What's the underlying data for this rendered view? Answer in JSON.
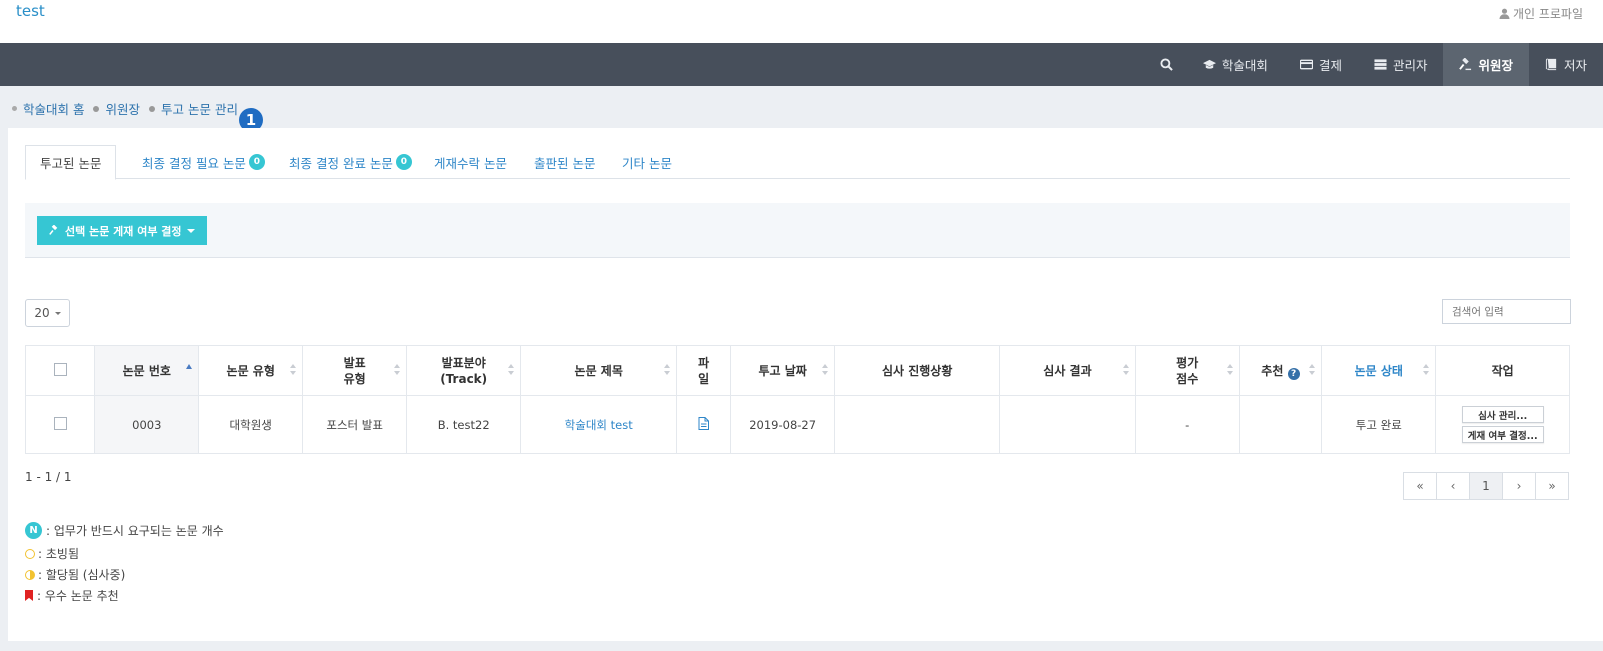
{
  "app": {
    "brand": "test",
    "profile_label": "개인 프로파일"
  },
  "nav": {
    "search_icon": "search-icon",
    "items": [
      {
        "label": "학술대회",
        "icon": "graduation-cap-icon"
      },
      {
        "label": "결제",
        "icon": "credit-card-icon"
      },
      {
        "label": "관리자",
        "icon": "server-icon"
      },
      {
        "label": "위원장",
        "icon": "gavel-icon",
        "active": true
      },
      {
        "label": "저자",
        "icon": "book-icon"
      }
    ]
  },
  "breadcrumb": [
    "학술대회 홈",
    "위원장",
    "투고 논문 관리"
  ],
  "step_badge": "1",
  "tabs": [
    {
      "label": "투고된 논문",
      "active": true
    },
    {
      "label": "최종 결정 필요 논문",
      "badge": "0"
    },
    {
      "label": "최종 결정 완료 논문",
      "badge": "0"
    },
    {
      "label": "게재수락 논문"
    },
    {
      "label": "출판된 논문"
    },
    {
      "label": "기타 논문"
    }
  ],
  "action": {
    "label": "선택 논문 게재 여부 결정"
  },
  "page_size": "20",
  "search": {
    "placeholder": "검색어 입력"
  },
  "table": {
    "headers": [
      "논문 번호",
      "논문 유형",
      "발표\n유형",
      "발표분야\n(Track)",
      "논문 제목",
      "파\n일",
      "투고 날짜",
      "심사 진행상황",
      "심사 결과",
      "평가\n점수",
      "추천",
      "논문 상태",
      "작업"
    ],
    "rows": [
      {
        "id": "0003",
        "type": "대학원생",
        "presentation": "포스터 발표",
        "track": "B. test22",
        "title": "학술대회 test",
        "date": "2019-08-27",
        "progress": "",
        "result": "",
        "score": "-",
        "recommend": "",
        "status": "투고 완료",
        "btn_review": "심사 관리...",
        "btn_decide": "게재 여부 결정..."
      }
    ]
  },
  "count_text": "1 - 1 / 1",
  "pager": [
    "«",
    "‹",
    "1",
    "›",
    "»"
  ],
  "legend": {
    "n_badge": "N",
    "required": ": 업무가 반드시 요구되는 논문 개수",
    "invited": ": 초빙됨",
    "assigned": ": 할당됨 (심사중)",
    "recommended": ": 우수 논문 추천"
  },
  "colors": {
    "accent": "#36c6d3",
    "navbar": "#474f5b",
    "link": "#2e86c8",
    "badge_blue": "#1f6cc2"
  }
}
